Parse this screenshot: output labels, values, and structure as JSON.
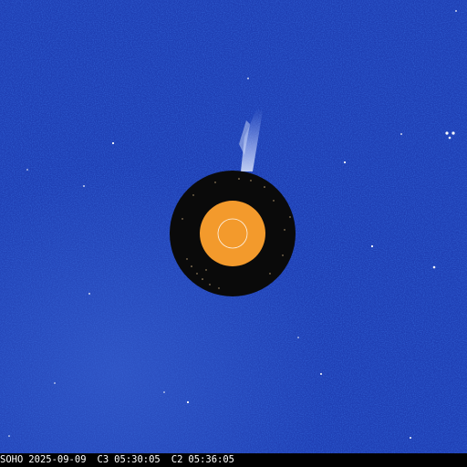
{
  "image": {
    "instrument": "SOHO",
    "date": "2025-09-09",
    "c3_label": "C3",
    "c3_time": "05:30:05",
    "c2_label": "C2",
    "c2_time": "05:36:05"
  },
  "colors": {
    "background_blue": "#1f3fb4",
    "occulter": "#0a0a0a",
    "inner_disk": "#f39a2c",
    "sun_outline": "#ffffff",
    "caption_bar": "#000000",
    "caption_text": "#ffffff"
  }
}
